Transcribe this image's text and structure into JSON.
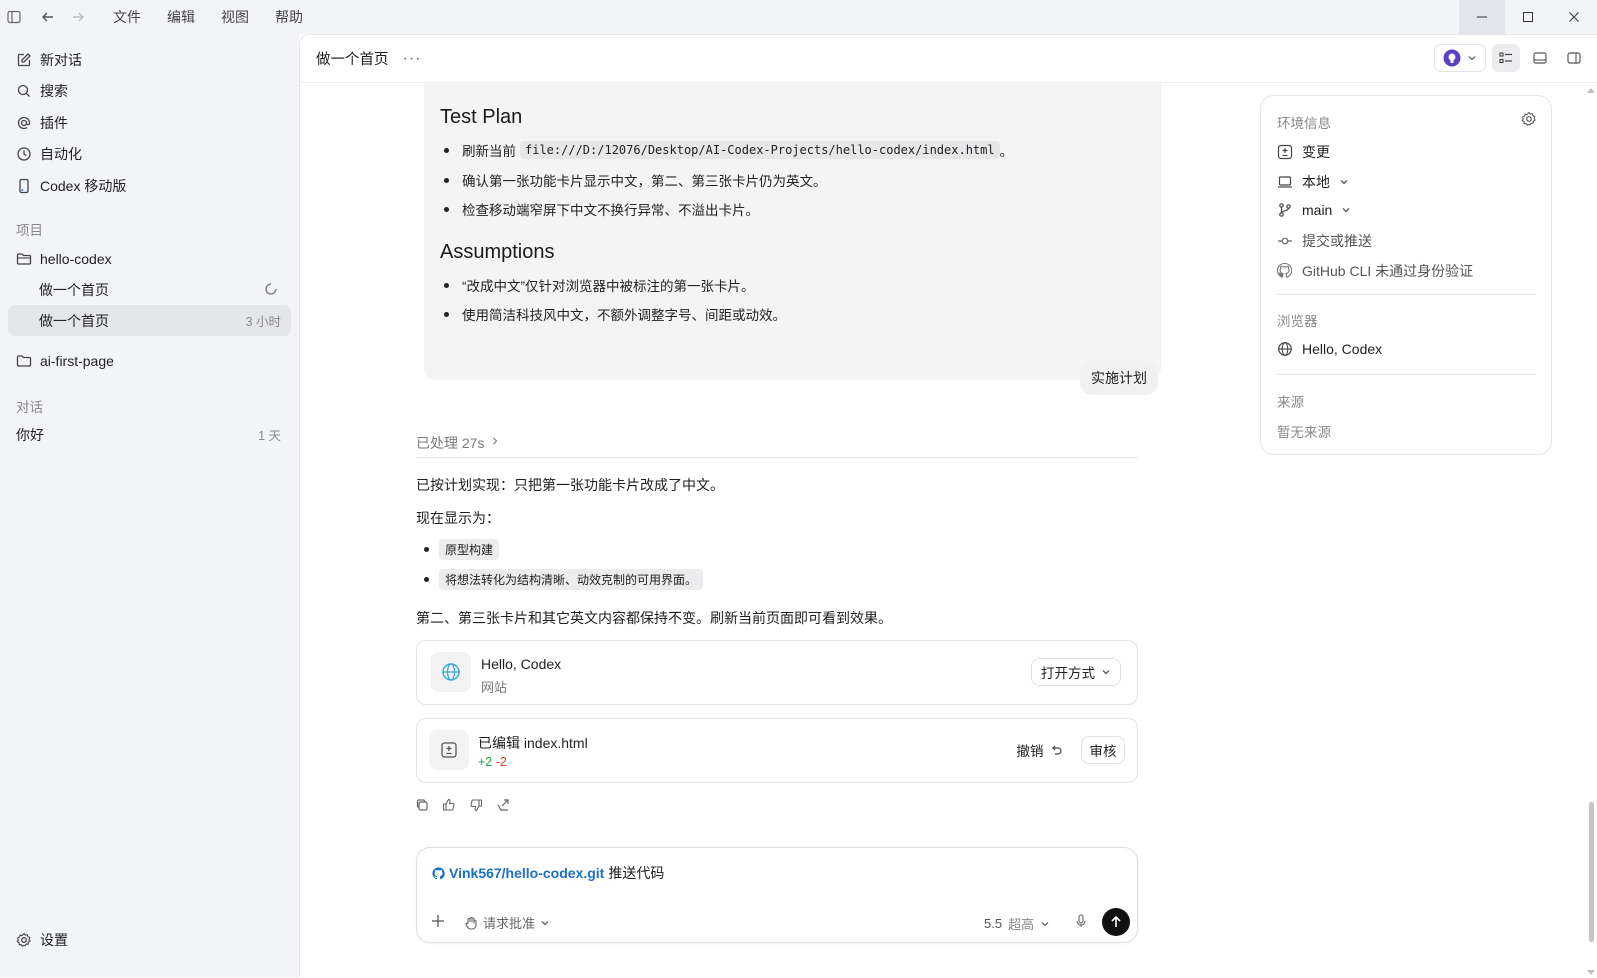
{
  "menu": [
    "文件",
    "编辑",
    "视图",
    "帮助"
  ],
  "sidebar": {
    "nav": [
      {
        "label": "新对话",
        "icon": "edit-icon"
      },
      {
        "label": "搜索",
        "icon": "search-icon"
      },
      {
        "label": "插件",
        "icon": "at-icon"
      },
      {
        "label": "自动化",
        "icon": "clock-icon"
      },
      {
        "label": "Codex 移动版",
        "icon": "mobile-icon"
      }
    ],
    "projects_label": "项目",
    "projects": [
      {
        "name": "hello-codex"
      },
      {
        "name": "ai-first-page"
      }
    ],
    "threads": [
      {
        "title": "做一个首页",
        "meta": ""
      },
      {
        "title": "做一个首页",
        "meta": "3 小时"
      }
    ],
    "conversations_label": "对话",
    "conversations": [
      {
        "title": "你好",
        "meta": "1 天"
      }
    ],
    "settings_label": "设置"
  },
  "header": {
    "title": "做一个首页",
    "more": "···"
  },
  "plan": {
    "test_heading": "Test Plan",
    "test_items": {
      "refresh_prefix": "刷新当前",
      "refresh_path": "file:///D:/12076/Desktop/AI-Codex-Projects/hello-codex/index.html",
      "refresh_suffix": "。",
      "item2": "确认第一张功能卡片显示中文，第二、第三张卡片仍为英文。",
      "item3": "检查移动端窄屏下中文不换行异常、不溢出卡片。"
    },
    "assumptions_heading": "Assumptions",
    "assumptions": [
      "“改成中文”仅针对浏览器中被标注的第一张卡片。",
      "使用简洁科技风中文，不额外调整字号、间距或动效。"
    ]
  },
  "user_bubble": "实施计划",
  "processed": "已处理 27s",
  "reply": {
    "p1": "已按计划实现：只把第一张功能卡片改成了中文。",
    "p2": "现在显示为：",
    "items": [
      "原型构建",
      "将想法转化为结构清晰、动效克制的可用界面。"
    ],
    "p3": "第二、第三张卡片和其它英文内容都保持不变。刷新当前页面即可看到效果。"
  },
  "site_card": {
    "title": "Hello, Codex",
    "subtitle": "网站",
    "open_label": "打开方式"
  },
  "edit_card": {
    "title": "已编辑 index.html",
    "added": "+2",
    "removed": "-2",
    "undo_label": "撤销",
    "review_label": "审核"
  },
  "composer": {
    "repo": "Vink567/hello-codex.git",
    "action": "推送代码",
    "approval": "请求批准",
    "model": "5.5",
    "effort": "超高"
  },
  "right_panel": {
    "env_label": "环境信息",
    "changes": "变更",
    "local": "本地",
    "branch": "main",
    "commit": "提交或推送",
    "gh": "GitHub CLI 未通过身份验证",
    "browser_label": "浏览器",
    "browser_item": "Hello, Codex",
    "source_label": "来源",
    "source_empty": "暂无来源"
  },
  "colors": {
    "accent_link": "#1a6fc9",
    "added": "#1a9e4b",
    "removed": "#d63b3b",
    "send": "#111111",
    "brand": "#5b3fc4"
  }
}
